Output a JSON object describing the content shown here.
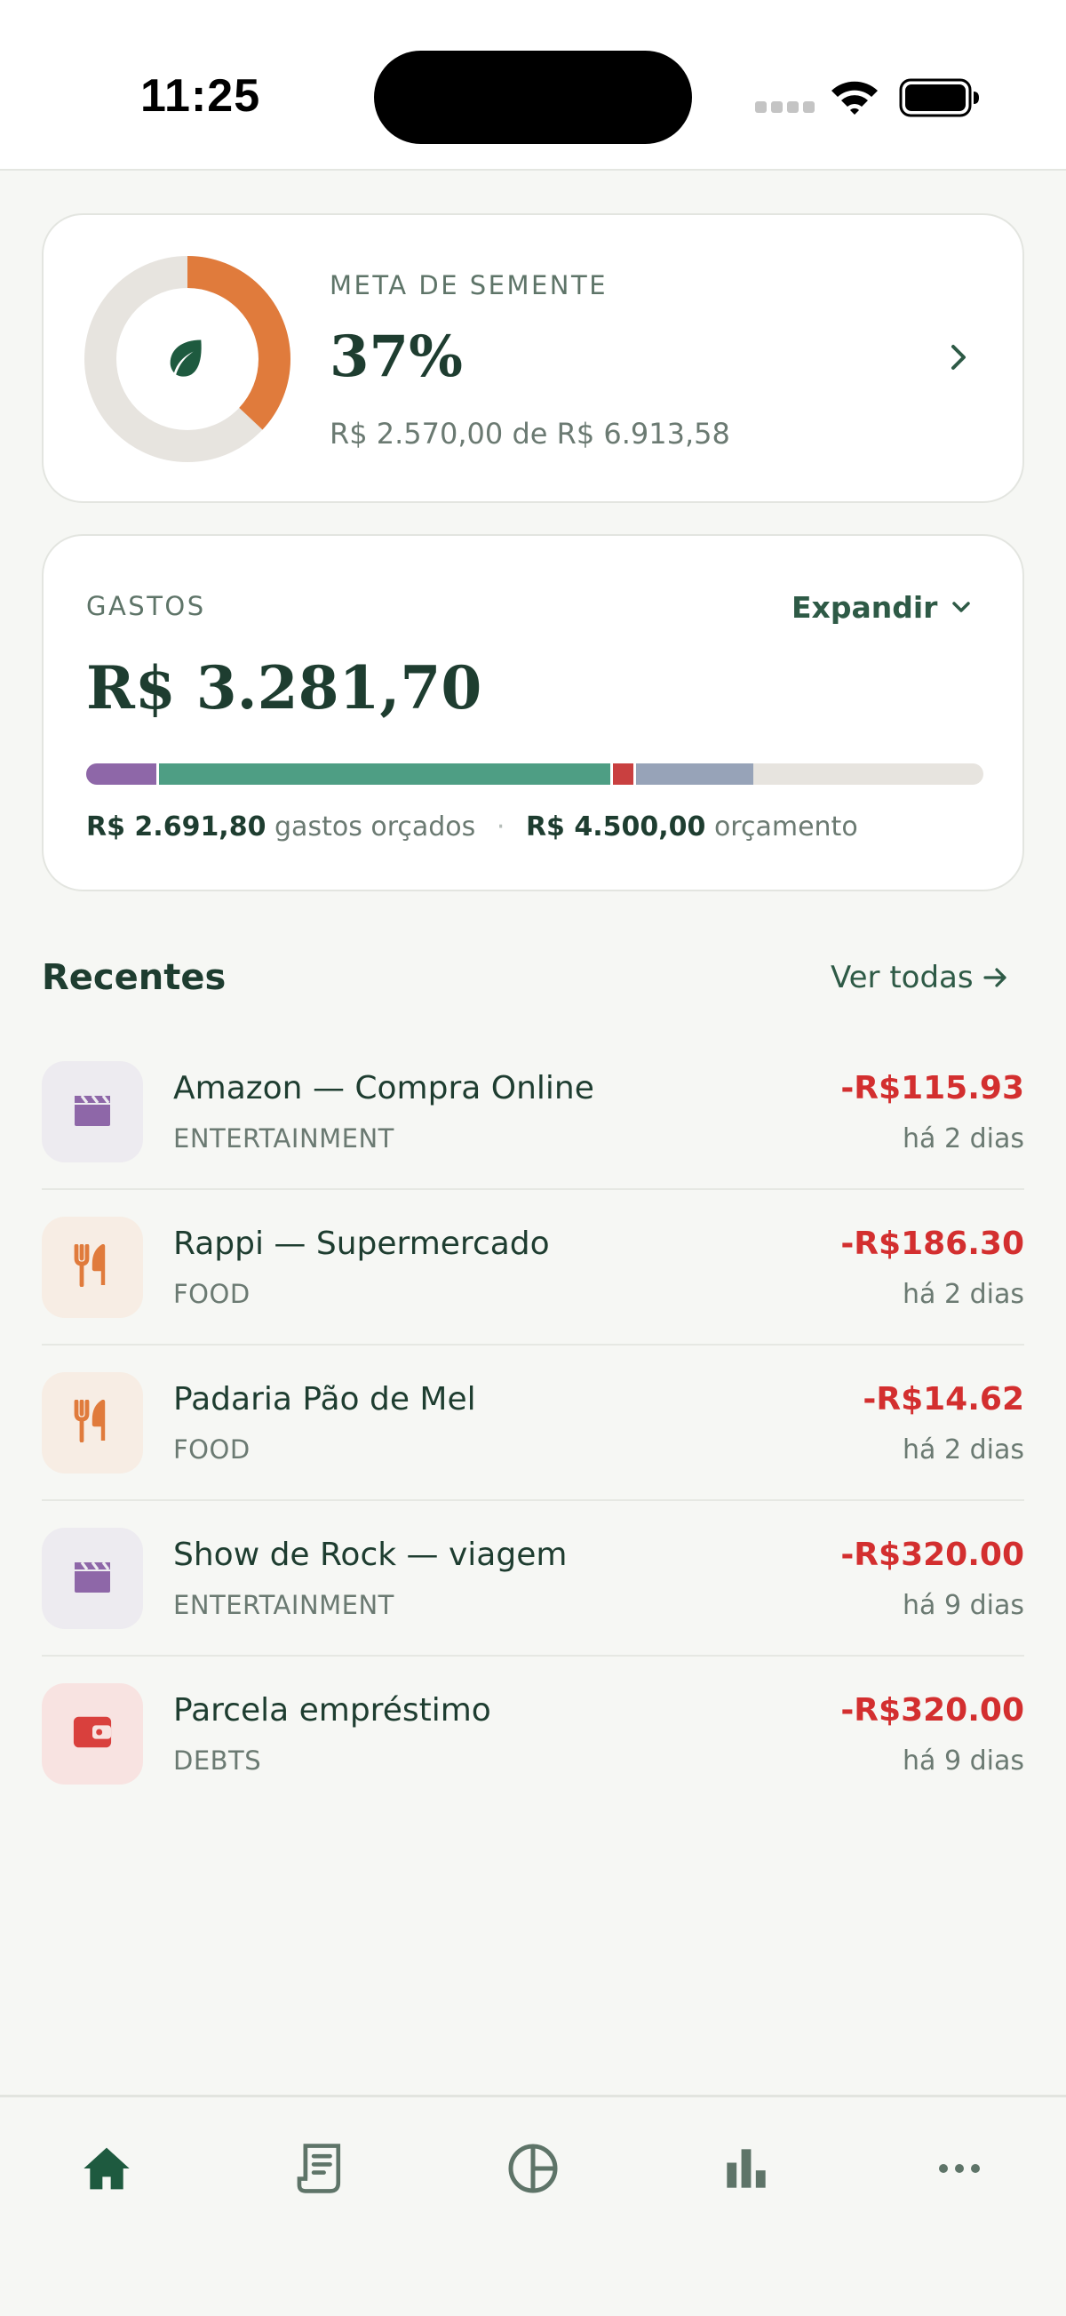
{
  "status_bar": {
    "time": "11:25"
  },
  "goal": {
    "label": "META DE SEMENTE",
    "percent": "37%",
    "progress": 0.37,
    "amount_text": "R$ 2.570,00 de R$ 6.913,58",
    "ring_color": "#E07B3C",
    "track_color": "#E7E4DF",
    "icon": "leaf-icon"
  },
  "spending": {
    "label": "GASTOS",
    "expand_label": "Expandir",
    "total": "R$ 3.281,70",
    "budgeted_amount": "R$ 2.691,80",
    "budgeted_text": "gastos orçados",
    "budget_amount": "R$ 4.500,00",
    "budget_text": "orçamento",
    "bar_segments": [
      {
        "share": 0.078,
        "color": "#8E67A8"
      },
      {
        "share": 0.503,
        "color": "#4E9E84"
      },
      {
        "share": 0.023,
        "color": "#C94040"
      },
      {
        "share": 0.131,
        "color": "#97A3B8"
      }
    ]
  },
  "recents": {
    "title": "Recentes",
    "see_all": "Ver todas",
    "items": [
      {
        "name": "Amazon — Compra Online",
        "category": "ENTERTAINMENT",
        "amount": "-R$115.93",
        "date": "há 2 dias",
        "icon": "clapperboard-icon"
      },
      {
        "name": "Rappi — Supermercado",
        "category": "FOOD",
        "amount": "-R$186.30",
        "date": "há 2 dias",
        "icon": "fork-knife-icon"
      },
      {
        "name": "Padaria Pão de Mel",
        "category": "FOOD",
        "amount": "-R$14.62",
        "date": "há 2 dias",
        "icon": "fork-knife-icon"
      },
      {
        "name": "Show de Rock — viagem",
        "category": "ENTERTAINMENT",
        "amount": "-R$320.00",
        "date": "há 9 dias",
        "icon": "clapperboard-icon"
      },
      {
        "name": "Parcela empréstimo",
        "category": "DEBTS",
        "amount": "-R$320.00",
        "date": "há 9 dias",
        "icon": "wallet-icon"
      }
    ]
  },
  "category_colors": {
    "entertainment": {
      "bg": "#EDEBF0",
      "fg": "#8E67A8"
    },
    "food": {
      "bg": "#F7EDE4",
      "fg": "#E07B3C"
    },
    "debts": {
      "bg": "#F8E3E1",
      "fg": "#D9403D"
    }
  },
  "tab_bar": {
    "tabs": [
      "home-icon",
      "receipt-icon",
      "pie-chart-icon",
      "bar-chart-icon",
      "more-icon"
    ],
    "active": "home-icon",
    "active_color": "#1E5A3F",
    "inactive_color": "#5E7468"
  }
}
